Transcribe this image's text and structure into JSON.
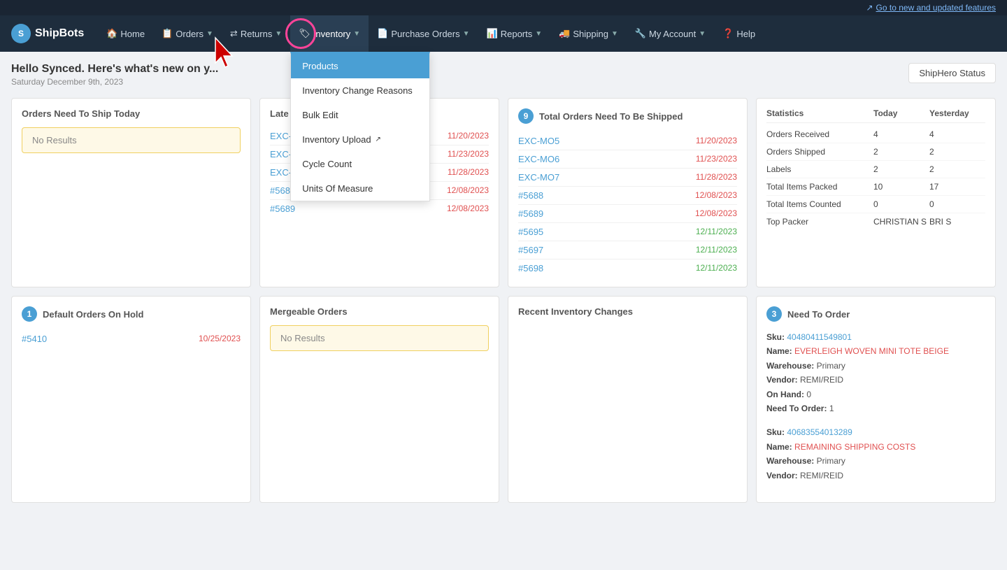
{
  "topBanner": {
    "linkText": "Go to new and updated features",
    "icon": "external-link-icon"
  },
  "navbar": {
    "logoText": "ShipBots",
    "items": [
      {
        "id": "home",
        "label": "Home",
        "icon": "home",
        "hasDropdown": false
      },
      {
        "id": "orders",
        "label": "Orders",
        "icon": "list",
        "hasDropdown": true
      },
      {
        "id": "returns",
        "label": "Returns",
        "icon": "exchange",
        "hasDropdown": true
      },
      {
        "id": "inventory",
        "label": "Inventory",
        "icon": "tag",
        "hasDropdown": true,
        "active": true
      },
      {
        "id": "purchase-orders",
        "label": "Purchase Orders",
        "icon": "file",
        "hasDropdown": true
      },
      {
        "id": "reports",
        "label": "Reports",
        "icon": "bar-chart",
        "hasDropdown": true
      },
      {
        "id": "shipping",
        "label": "Shipping",
        "icon": "truck",
        "hasDropdown": true
      },
      {
        "id": "my-account",
        "label": "My Account",
        "icon": "wrench",
        "hasDropdown": true
      },
      {
        "id": "help",
        "label": "Help",
        "icon": "question",
        "hasDropdown": false
      }
    ],
    "inventoryDropdown": {
      "items": [
        {
          "id": "products",
          "label": "Products",
          "highlighted": true,
          "external": false
        },
        {
          "id": "inventory-change-reasons",
          "label": "Inventory Change Reasons",
          "highlighted": false,
          "external": false
        },
        {
          "id": "bulk-edit",
          "label": "Bulk Edit",
          "highlighted": false,
          "external": false
        },
        {
          "id": "inventory-upload",
          "label": "Inventory Upload",
          "highlighted": false,
          "external": true
        },
        {
          "id": "cycle-count",
          "label": "Cycle Count",
          "highlighted": false,
          "external": false
        },
        {
          "id": "units-of-measure",
          "label": "Units Of Measure",
          "highlighted": false,
          "external": false
        }
      ]
    }
  },
  "pageHeader": {
    "welcomeTitle": "Hello Synced. Here's what's new on y...",
    "welcomeDate": "Saturday December 9th, 2023",
    "shipStatusLabel": "ShipHero Status"
  },
  "ordersToShip": {
    "title": "Orders Need To Ship Today",
    "noResults": "No Results"
  },
  "lateOrders": {
    "title": "Late",
    "orders": [
      {
        "id": "EXC-MO5",
        "date": "11/20/2023",
        "late": true
      },
      {
        "id": "EXC-MO6",
        "date": "11/23/2023",
        "late": true
      },
      {
        "id": "EXC-MO7",
        "date": "11/28/2023",
        "late": true
      },
      {
        "id": "#5688",
        "date": "12/08/2023",
        "late": true
      },
      {
        "id": "#5689",
        "date": "12/08/2023",
        "late": true
      }
    ]
  },
  "totalOrders": {
    "count": "9",
    "title": "Total Orders Need To Be Shipped",
    "orders": [
      {
        "id": "EXC-MO5",
        "date": "11/20/2023",
        "color": "red"
      },
      {
        "id": "EXC-MO6",
        "date": "11/23/2023",
        "color": "red"
      },
      {
        "id": "EXC-MO7",
        "date": "11/28/2023",
        "color": "red"
      },
      {
        "id": "#5688",
        "date": "12/08/2023",
        "color": "red"
      },
      {
        "id": "#5689",
        "date": "12/08/2023",
        "color": "red"
      },
      {
        "id": "#5695",
        "date": "12/11/2023",
        "color": "green"
      },
      {
        "id": "#5697",
        "date": "12/11/2023",
        "color": "green"
      },
      {
        "id": "#5698",
        "date": "12/11/2023",
        "color": "green"
      }
    ]
  },
  "statistics": {
    "title": "Statistics",
    "colToday": "Today",
    "colYesterday": "Yesterday",
    "rows": [
      {
        "label": "Orders Received",
        "today": "4",
        "yesterday": "4"
      },
      {
        "label": "Orders Shipped",
        "today": "2",
        "yesterday": "2"
      },
      {
        "label": "Labels",
        "today": "2",
        "yesterday": "2"
      },
      {
        "label": "Total Items Packed",
        "today": "10",
        "yesterday": "17"
      },
      {
        "label": "Total Items Counted",
        "today": "0",
        "yesterday": "0"
      },
      {
        "label": "Top Packer",
        "today": "CHRISTIAN S",
        "yesterday": "BRI S"
      }
    ]
  },
  "defaultOrdersOnHold": {
    "count": "1",
    "title": "Default Orders On Hold",
    "orders": [
      {
        "id": "#5410",
        "date": "10/25/2023",
        "color": "red"
      }
    ]
  },
  "mergeableOrders": {
    "title": "Mergeable Orders",
    "noResults": "No Results"
  },
  "recentInventoryChanges": {
    "title": "Recent Inventory Changes"
  },
  "needToOrder": {
    "count": "3",
    "title": "Need To Order",
    "items": [
      {
        "sku": "40480411549801",
        "name": "EVERLEIGH WOVEN MINI TOTE BEIGE",
        "warehouse": "Primary",
        "vendor": "REMI/REID",
        "onHand": "0",
        "needToOrder": "1"
      },
      {
        "sku": "40683554013289",
        "name": "REMAINING SHIPPING COSTS",
        "warehouse": "Primary",
        "vendor": "REMI/REID"
      }
    ],
    "labels": {
      "sku": "Sku:",
      "name": "Name:",
      "warehouse": "Warehouse:",
      "vendor": "Vendor:",
      "onHand": "On Hand:",
      "needToOrder": "Need To Order:"
    }
  }
}
